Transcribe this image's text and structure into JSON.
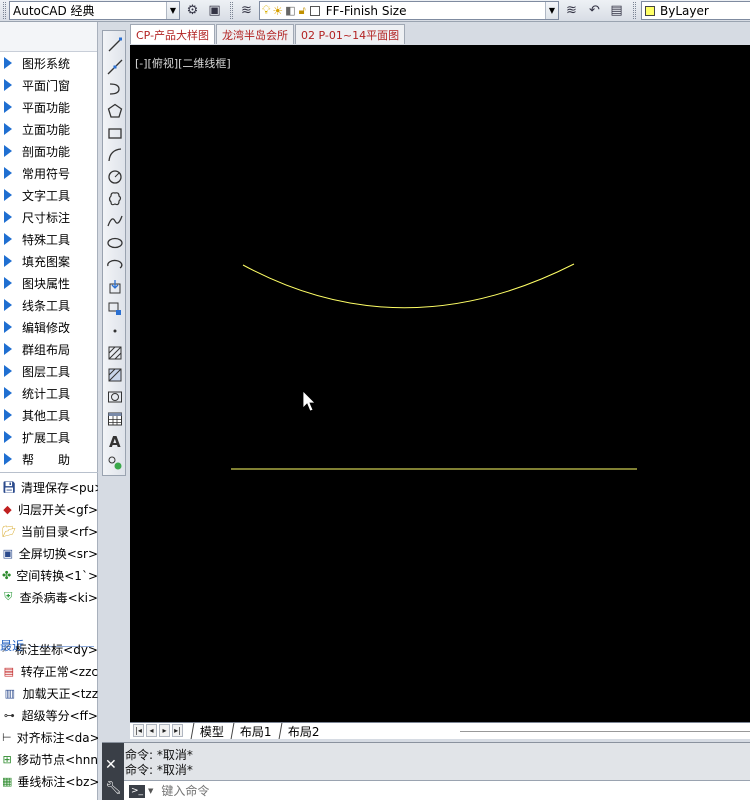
{
  "toolbar": {
    "workspace": "AutoCAD 经典",
    "layer": "FF-Finish Size",
    "color": "ByLayer"
  },
  "left_menu": {
    "items": [
      {
        "label": "图形系统"
      },
      {
        "label": "平面门窗"
      },
      {
        "label": "平面功能"
      },
      {
        "label": "立面功能"
      },
      {
        "label": "剖面功能"
      },
      {
        "label": "常用符号"
      },
      {
        "label": "文字工具"
      },
      {
        "label": "尺寸标注"
      },
      {
        "label": "特殊工具"
      },
      {
        "label": "填充图案"
      },
      {
        "label": "图块属性"
      },
      {
        "label": "线条工具"
      },
      {
        "label": "编辑修改"
      },
      {
        "label": "群组布局"
      },
      {
        "label": "图层工具"
      },
      {
        "label": "统计工具"
      },
      {
        "label": "其他工具"
      },
      {
        "label": "扩展工具"
      },
      {
        "label": "帮　　助"
      }
    ],
    "commands": [
      {
        "label": "清理保存<pu>",
        "icon": "floppy-icon"
      },
      {
        "label": "归层开关<gf>",
        "icon": "layers-icon"
      },
      {
        "label": "当前目录<rf>",
        "icon": "folder-icon"
      },
      {
        "label": "全屏切换<sr>",
        "icon": "fullscreen-icon"
      },
      {
        "label": "空间转换<1`>",
        "icon": "space-icon"
      },
      {
        "label": "查杀病毒<ki>",
        "icon": "shield-icon"
      }
    ],
    "recent_label": "最近",
    "recent": [
      {
        "label": "标注坐标<dy>",
        "icon": "coord-icon"
      },
      {
        "label": "转存正常<zzc",
        "icon": "save-as-icon"
      },
      {
        "label": "加载天正<tzz",
        "icon": "load-icon"
      },
      {
        "label": "超级等分<ff>",
        "icon": "divide-icon"
      },
      {
        "label": "对齐标注<da>",
        "icon": "align-dim-icon"
      },
      {
        "label": "移动节点<hnn",
        "icon": "move-node-icon"
      },
      {
        "label": "垂线标注<bz>",
        "icon": "perp-dim-icon"
      }
    ]
  },
  "file_tabs": [
    {
      "label": "CP-产品大样图"
    },
    {
      "label": "龙湾半岛会所"
    },
    {
      "label": "02 P-01~14平面图"
    }
  ],
  "viewport": {
    "label": "[-][俯视][二维线框]",
    "background": "#000000",
    "linework_color": "#ffff66"
  },
  "layout_tabs": [
    "模型",
    "布局1",
    "布局2"
  ],
  "command": {
    "history": [
      "命令: *取消*",
      "命令: *取消*"
    ],
    "placeholder": "键入命令"
  }
}
